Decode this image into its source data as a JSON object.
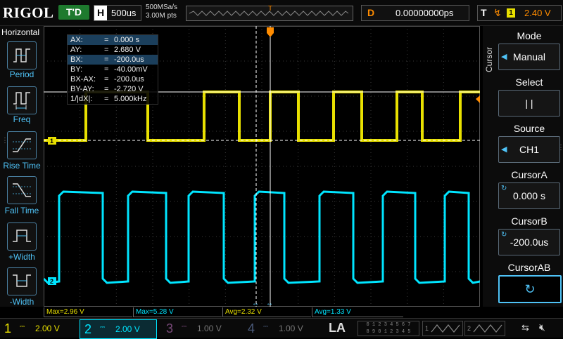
{
  "brand": "RIGOL",
  "top": {
    "trigger_status": "T'D",
    "h_label": "H",
    "timebase": "500us",
    "sample_rate": "500MSa/s",
    "memory_depth": "3.00M pts",
    "delay_label": "D",
    "delay_value": "0.00000000ps",
    "trig_label": "T",
    "trig_source": "1",
    "trig_level": "2.40 V"
  },
  "left_panel": {
    "title": "Horizontal",
    "items": [
      {
        "label": "Period",
        "icon": "period-icon"
      },
      {
        "label": "Freq",
        "icon": "freq-icon"
      },
      {
        "label": "Rise Time",
        "icon": "rise-time-icon"
      },
      {
        "label": "Fall Time",
        "icon": "fall-time-icon"
      },
      {
        "label": "+Width",
        "icon": "plus-width-icon"
      },
      {
        "label": "-Width",
        "icon": "minus-width-icon"
      }
    ]
  },
  "cursor_readout": [
    {
      "key": "AX:",
      "value": "0.000 s",
      "highlight": true
    },
    {
      "key": "AY:",
      "value": "2.680 V",
      "highlight": false
    },
    {
      "key": "BX:",
      "value": "-200.0us",
      "highlight": true
    },
    {
      "key": "BY:",
      "value": "-40.00mV",
      "highlight": false
    },
    {
      "key": "BX-AX:",
      "value": "-200.0us",
      "highlight": false
    },
    {
      "key": "BY-AY:",
      "value": "-2.720 V",
      "highlight": false
    },
    {
      "key": "1/|dX|:",
      "value": "5.000kHz",
      "highlight": false
    }
  ],
  "right_panel": {
    "vertical_label": "Cursor",
    "mode_title": "Mode",
    "mode_value": "Manual",
    "select_title": "Select",
    "select_value": "| |",
    "source_title": "Source",
    "source_value": "CH1",
    "cursor_a_title": "CursorA",
    "cursor_a_value": "0.000 s",
    "cursor_b_title": "CursorB",
    "cursor_b_value": "-200.0us",
    "cursor_ab_title": "CursorAB",
    "cursor_ab_icon": "refresh-icon"
  },
  "markers": {
    "ch1": "1",
    "ch2": "2",
    "trigger_pos": "T"
  },
  "measurements": [
    {
      "text": "Max=2.96 V",
      "color": "#e8e000"
    },
    {
      "text": "Max=5.28 V",
      "color": "#00e5ff"
    },
    {
      "text": "Avg=2.32 V",
      "color": "#e8e000"
    },
    {
      "text": "Avg=1.33 V",
      "color": "#00e5ff"
    }
  ],
  "channels": [
    {
      "num": "1",
      "coupling": "DC",
      "volts": "2.00 V",
      "color": "#e8e000",
      "active": false
    },
    {
      "num": "2",
      "coupling": "DC",
      "volts": "2.00 V",
      "color": "#00e5ff",
      "active": true
    },
    {
      "num": "3",
      "coupling": "DC",
      "volts": "1.00 V",
      "color": "#6a3a6a",
      "active": false
    },
    {
      "num": "4",
      "coupling": "DC",
      "volts": "1.00 V",
      "color": "#3a4a6a",
      "active": false
    }
  ],
  "bottom": {
    "la_label": "LA",
    "la_digits_row1": "0 1 2 3  4 5 6 7",
    "la_digits_row2": "8 9 0 1  2 3 4 5",
    "gen1": "1",
    "gen2": "2"
  },
  "colors": {
    "ch1": "#e8e000",
    "ch2": "#00e5ff",
    "cursor": "#ffffff",
    "trigger": "#ff8c00",
    "accent": "#4fc3f7"
  }
}
